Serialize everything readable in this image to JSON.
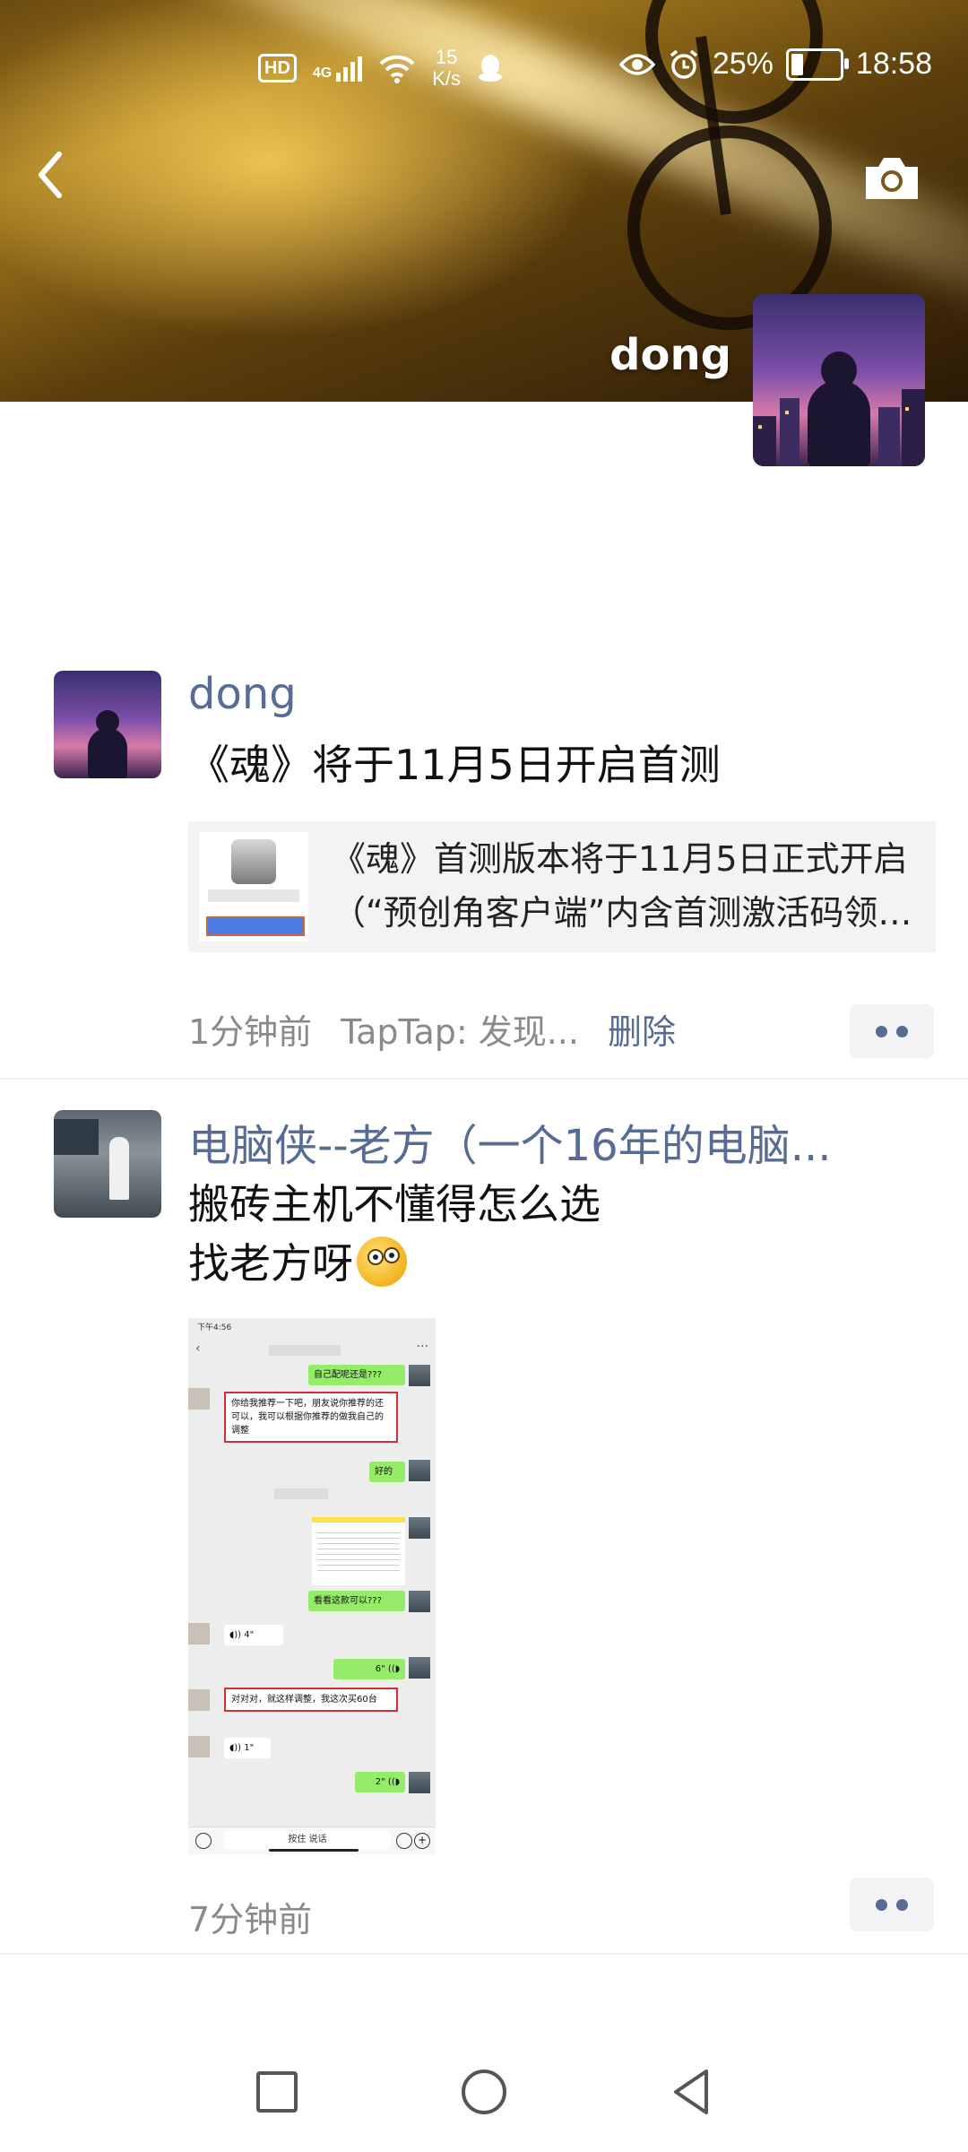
{
  "status_bar": {
    "hd": "HD",
    "signal_label": "4G",
    "net_speed_value": "15",
    "net_speed_unit": "K/s",
    "battery": "25%",
    "battery_level": 0.25,
    "time": "18:58"
  },
  "cover": {
    "user_name": "dong"
  },
  "posts": [
    {
      "author": "dong",
      "text": "《魂》将于11月5日开启首测",
      "link": {
        "title": "《魂》首测版本将于11月5日正式开启（“预创角客户端”内含首测激活码领取方式）"
      },
      "time": "1分钟前",
      "source": "TapTap: 发现...",
      "delete_label": "删除"
    },
    {
      "author": "电脑侠--老方（一个16年的电脑...",
      "text_line1": "搬砖主机不懂得怎么选",
      "text_line2": "找老方呀",
      "time": "7分钟前",
      "chat_image": {
        "time": "下午4:56",
        "msg1": "自己配呢还是???",
        "msg2": "你给我推荐一下吧，朋友说你推荐的还可以，我可以根据你推荐的做我自己的调整",
        "msg3": "好的",
        "msg4": "看看这款可以???",
        "voice1": "4\"",
        "voice2": "6\"",
        "msg5": "对对对，就这样调整，我这次买60台",
        "voice3": "1\"",
        "voice4": "2\"",
        "hold_to_talk": "按住 说话"
      }
    }
  ],
  "icons": {
    "back": "chevron-left-icon",
    "camera": "camera-icon",
    "more": "more-dots-icon",
    "nav_recent": "square-icon",
    "nav_home": "circle-icon",
    "nav_back": "triangle-back-icon"
  },
  "colors": {
    "link_blue": "#576b95",
    "meta_gray": "#8a8a8a",
    "card_bg": "#f3f3f5"
  }
}
